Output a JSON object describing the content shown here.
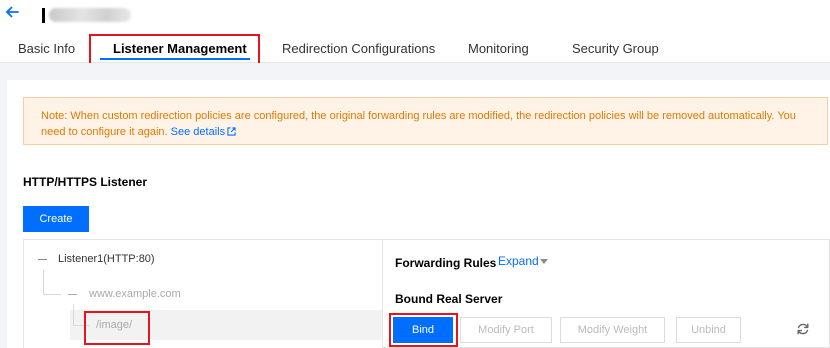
{
  "header": {
    "back_icon": "arrow-left-icon"
  },
  "tabs": [
    {
      "label": "Basic Info"
    },
    {
      "label": "Listener Management"
    },
    {
      "label": "Redirection Configurations"
    },
    {
      "label": "Monitoring"
    },
    {
      "label": "Security Group"
    }
  ],
  "active_tab": "Listener Management",
  "notice": {
    "text": "Note: When custom redirection policies are configured, the original forwarding rules are modified, the redirection policies will be removed automatically. You need to configure it again.",
    "link_label": "See details",
    "link_icon": "external-link-icon"
  },
  "section": {
    "title": "HTTP/HTTPS Listener",
    "create_label": "Create"
  },
  "tree": {
    "listener": "Listener1(HTTP:80)",
    "domain": "www.example.com",
    "path": "/image/"
  },
  "detail": {
    "forwarding_rules_title": "Forwarding Rules",
    "expand_label": "Expand",
    "bound_real_server_title": "Bound Real Server",
    "buttons": {
      "bind": "Bind",
      "modify_port": "Modify Port",
      "modify_weight": "Modify Weight",
      "unbind": "Unbind"
    },
    "refresh_icon": "refresh-icon"
  },
  "colors": {
    "accent": "#006eff",
    "highlight": "#e4151c",
    "notice_bg": "#fef3e6",
    "notice_text": "#e07a00"
  }
}
